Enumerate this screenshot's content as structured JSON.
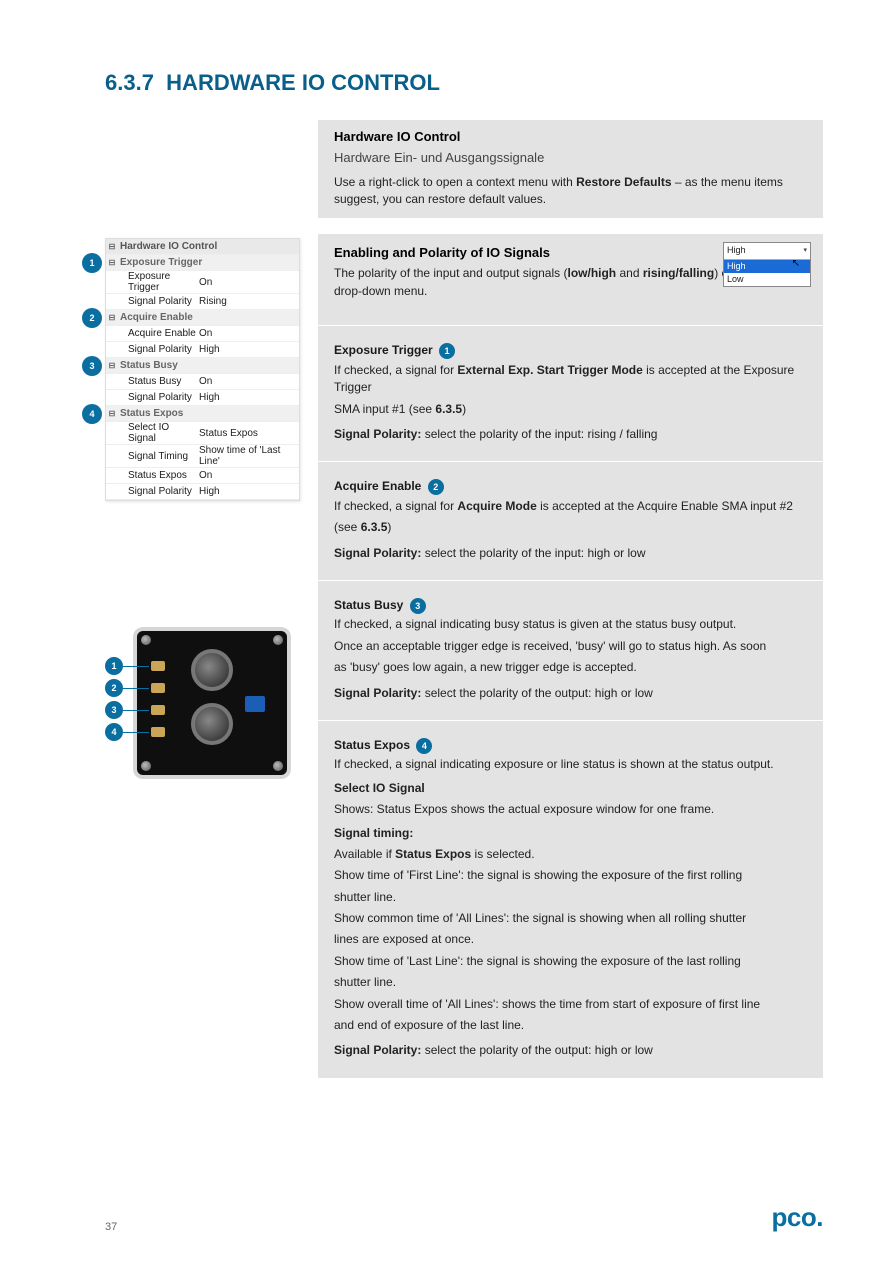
{
  "section_number": "6.3.7",
  "section_title": "HARDWARE IO CONTROL",
  "intro_box": {
    "title_en": "Hardware IO Control",
    "title_de": "Hardware Ein- und Ausgangssignale",
    "body1": "Use a right-click to open a context menu with ",
    "restore": "Restore Defaults",
    "body2": " – as the menu items suggest, you can restore default values."
  },
  "box1": {
    "title_en": "Enabling and Polarity of IO Signals",
    "body1": "The polarity of the input and output signals (",
    "low_high": "low/high ",
    "and": "and ",
    "rise_fall": "rising/falling",
    "body2": ") can be set via drop-down menu."
  },
  "box2": {
    "header": "Exposure Trigger",
    "badge": "1",
    "body1": "If checked, a signal for ",
    "inbold": "External Exp. Start Trigger Mode",
    "body2": " is accepted at the Exposure Trigger",
    "body3": "SMA input #1 (see ",
    "ref": "6.3.5",
    "body4": ")",
    "polarity_label": "Signal Polarity: ",
    "polarity_val": "select the polarity of the input: rising / falling"
  },
  "box3": {
    "header": "Acquire Enable",
    "badge": "2",
    "body1": "If checked, a signal for ",
    "inbold": "Acquire Mode",
    "body2": " is accepted at the Acquire Enable SMA input #2",
    "body3": "(see ",
    "ref": "6.3.5",
    "body4": ")",
    "polarity_label": "Signal Polarity: ",
    "polarity_val": "select the polarity of the input: high or low"
  },
  "box4": {
    "header": "Status Busy",
    "badge": "3",
    "body1": "If checked, a signal indicating busy status is given at the status busy output.",
    "body2": "Once an acceptable trigger edge is received, 'busy' will go to status high. As soon",
    "body3": "as 'busy' goes low again, a new trigger edge is accepted.",
    "polarity_label": "Signal Polarity: ",
    "polarity_val": "select the polarity of the output: high or low"
  },
  "box5": {
    "header": "Status Expos",
    "badge": "4",
    "body1": "If checked, a signal indicating exposure or line status is shown at the status output.",
    "sel_label": "Select IO Signal",
    "sel_opt1": "Shows: Status Expos shows the actual exposure window for one frame.",
    "timing_label": "Signal timing:",
    "timing_body1": "Available if ",
    "timing_bold": "Status Expos",
    "timing_body2": " is selected.",
    "timing_line1": "Show time of 'First Line': the signal is showing the exposure of the first rolling",
    "timing_line2": "shutter line.",
    "timing_line3": "Show common time of 'All Lines': the signal is showing when all rolling shutter",
    "timing_line4": "lines are exposed at once.",
    "timing_line5": "Show time of 'Last Line': the signal is showing the exposure of the last rolling",
    "timing_line6": "shutter line.",
    "timing_line7": "Show overall time of 'All Lines': shows the time from start of exposure of first line",
    "timing_line8": "and end of exposure of the last line.",
    "polarity_label": "Signal Polarity: ",
    "polarity_val": "select the polarity of the output: high or low"
  },
  "propgrid": {
    "root": "Hardware IO Control",
    "groups": [
      {
        "name": "Exposure Trigger",
        "badge": "1",
        "rows": [
          {
            "k": "Exposure Trigger",
            "v": "On"
          },
          {
            "k": "Signal Polarity",
            "v": "Rising"
          }
        ]
      },
      {
        "name": "Acquire Enable",
        "badge": "2",
        "rows": [
          {
            "k": "Acquire Enable",
            "v": "On"
          },
          {
            "k": "Signal Polarity",
            "v": "High"
          }
        ]
      },
      {
        "name": "Status Busy",
        "badge": "3",
        "rows": [
          {
            "k": "Status Busy",
            "v": "On"
          },
          {
            "k": "Signal Polarity",
            "v": "High"
          }
        ]
      },
      {
        "name": "Status Expos",
        "badge": "4",
        "rows": [
          {
            "k": "Select IO Signal",
            "v": "Status Expos"
          },
          {
            "k": "Signal Timing",
            "v": "Show time of 'Last Line'"
          },
          {
            "k": "Status Expos",
            "v": "On"
          },
          {
            "k": "Signal Polarity",
            "v": "High"
          }
        ]
      }
    ]
  },
  "dropdown": {
    "selected": "High",
    "options": [
      "High",
      "Low"
    ]
  },
  "camera": {
    "badges": [
      "1",
      "2",
      "3",
      "4"
    ]
  },
  "footer": {
    "page": "37",
    "logo": "pco."
  }
}
